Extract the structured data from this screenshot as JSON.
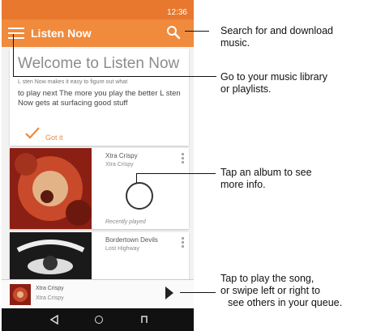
{
  "status_bar": {
    "time": "12:36"
  },
  "app_bar": {
    "title": "Listen Now"
  },
  "welcome_card": {
    "title": "Welcome to Listen Now",
    "small_text": "L sten Now makes it easy to figure out what",
    "body_text": "to play next The more you play the better L sten Now gets at surfacing good stuff",
    "action_label": "Got it"
  },
  "albums": [
    {
      "title": "Xtra Crispy",
      "artist": "Xtra Crispy",
      "status": "Recently played"
    },
    {
      "title": "Bordertown Devils",
      "artist": "Lost Highway"
    }
  ],
  "now_playing": {
    "title": "Xtra Crispy",
    "artist": "Xtra Crispy"
  },
  "callouts": {
    "search": [
      "Search for and download",
      "music."
    ],
    "library": [
      "Go to your music library",
      "or playlists."
    ],
    "album": [
      "Tap an album to see",
      "more info."
    ],
    "play": [
      "Tap to play the song,",
      "or swipe left or right to",
      "see others in your queue."
    ]
  },
  "colors": {
    "status_bar": "#e8782e",
    "app_bar": "#f08a3c",
    "accent": "#f08a3c",
    "nav_bar": "#111111"
  }
}
